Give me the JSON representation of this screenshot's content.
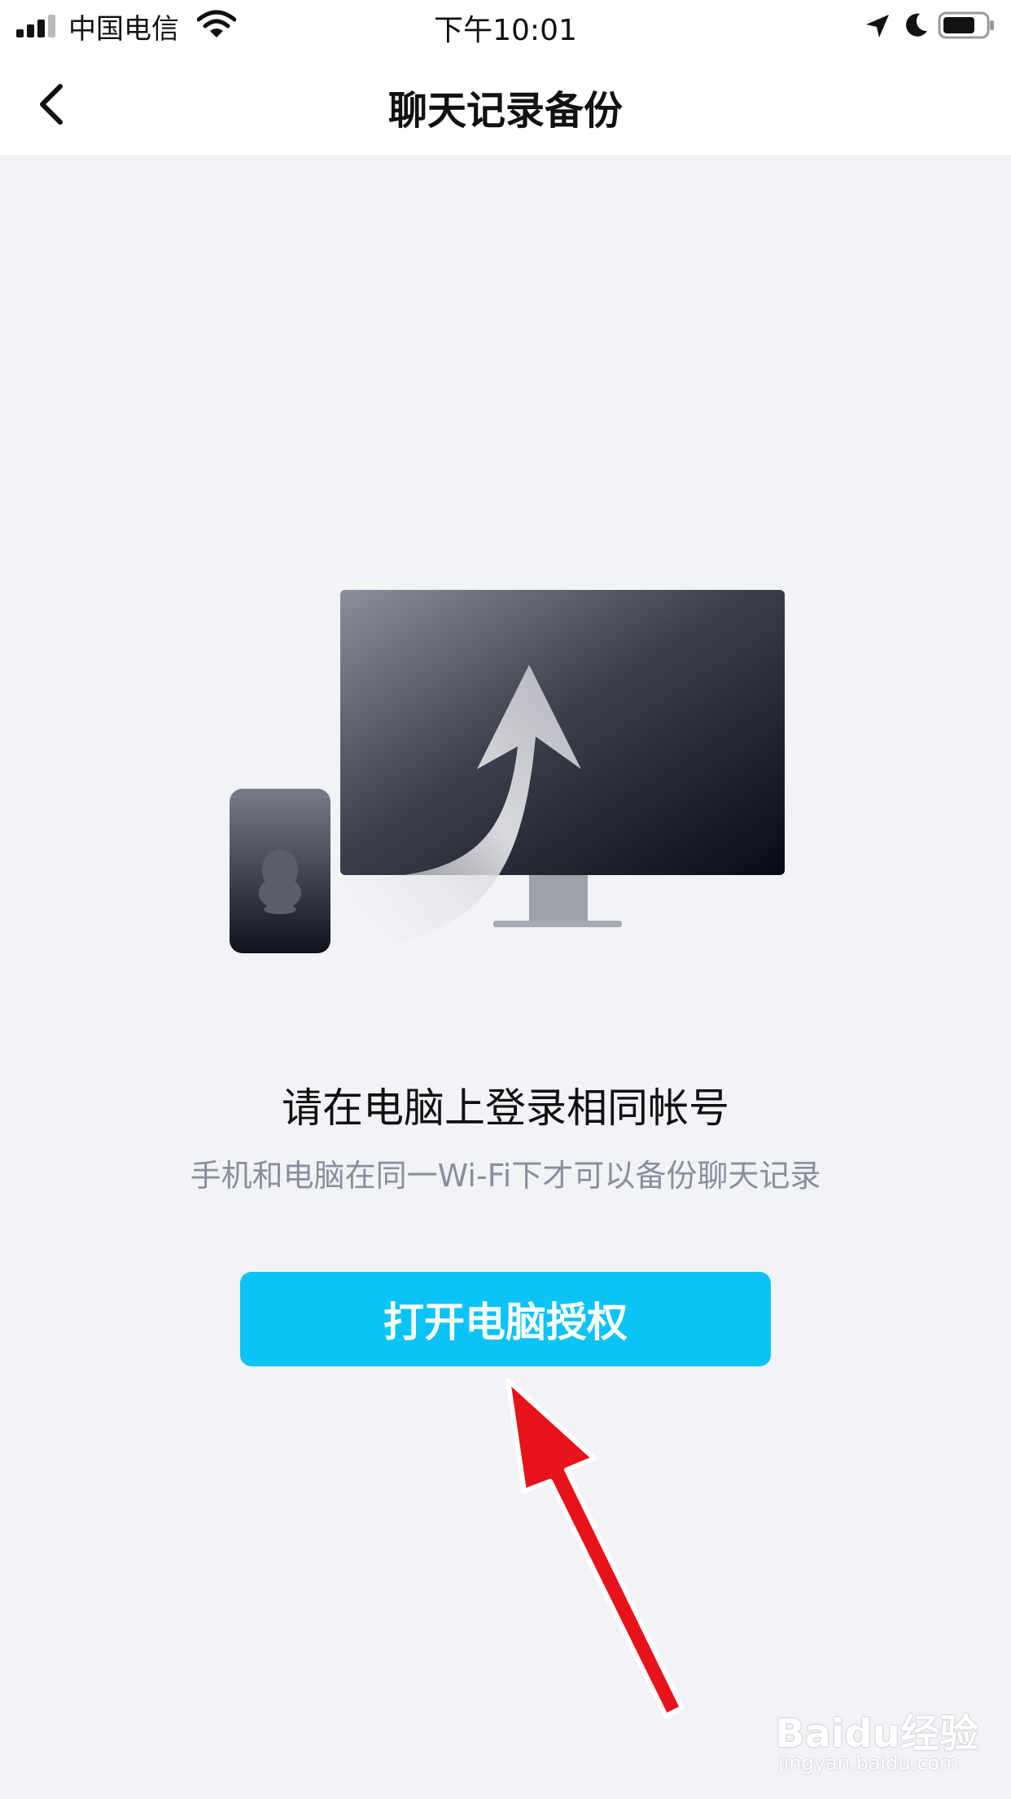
{
  "status_bar": {
    "carrier": "中国电信",
    "time": "下午10:01"
  },
  "nav": {
    "title": "聊天记录备份"
  },
  "content": {
    "headline": "请在电脑上登录相同帐号",
    "subline": "手机和电脑在同一Wi-Fi下才可以备份聊天记录",
    "button_label": "打开电脑授权"
  },
  "watermark": {
    "main": "Baidu经验",
    "sub": "jingyan.baidu.com"
  },
  "colors": {
    "accent": "#0bc3f7",
    "background": "#f2f3f7",
    "annotation_arrow": "#e8121a"
  },
  "icons": [
    "signal-icon",
    "wifi-icon",
    "back-chevron-icon",
    "location-icon",
    "moon-icon",
    "battery-icon",
    "qq-penguin-icon"
  ]
}
